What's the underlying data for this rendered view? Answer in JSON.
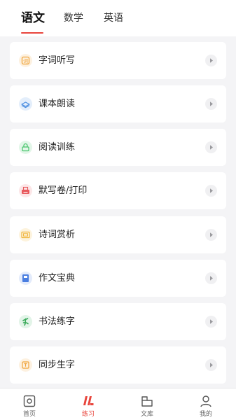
{
  "tabs": [
    {
      "label": "语文",
      "active": true
    },
    {
      "label": "数学",
      "active": false
    },
    {
      "label": "英语",
      "active": false
    }
  ],
  "menu": [
    {
      "label": "字词听写",
      "icon": "word-icon",
      "color": "#f0a43a"
    },
    {
      "label": "课本朗读",
      "icon": "book-icon",
      "color": "#4a8de0"
    },
    {
      "label": "阅读训练",
      "icon": "reading-icon",
      "color": "#45c46a"
    },
    {
      "label": "默写卷/打印",
      "icon": "printer-icon",
      "color": "#e8585c"
    },
    {
      "label": "诗词赏析",
      "icon": "poem-icon",
      "color": "#f0b43a"
    },
    {
      "label": "作文宝典",
      "icon": "essay-icon",
      "color": "#4a7ee0"
    },
    {
      "label": "书法练字",
      "icon": "brush-icon",
      "color": "#3aaa5a"
    },
    {
      "label": "同步生字",
      "icon": "character-icon",
      "color": "#f0a43a"
    }
  ],
  "bottom_nav": [
    {
      "label": "首页",
      "icon": "home-icon",
      "active": false
    },
    {
      "label": "练习",
      "icon": "practice-icon",
      "active": true
    },
    {
      "label": "文库",
      "icon": "library-icon",
      "active": false
    },
    {
      "label": "我的",
      "icon": "profile-icon",
      "active": false
    }
  ],
  "colors": {
    "accent": "#e8453c",
    "background": "#f4f4f6",
    "card": "#ffffff"
  }
}
